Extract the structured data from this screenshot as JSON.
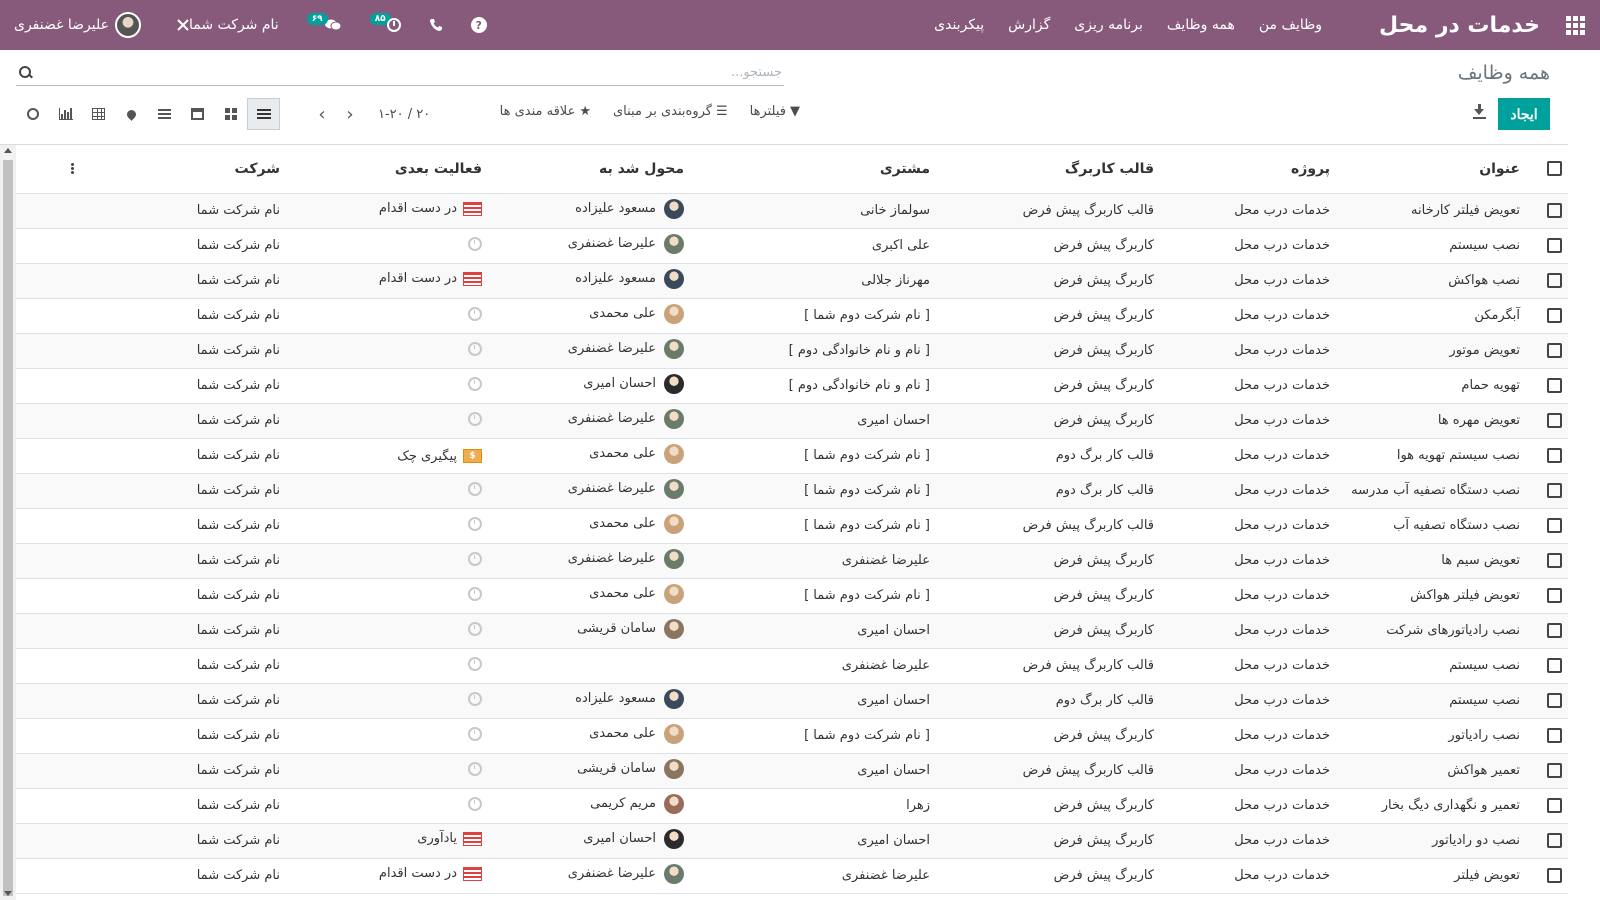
{
  "navbar": {
    "brand": "خدمات در محل",
    "menu": [
      "وظایف من",
      "همه وظایف",
      "برنامه ریزی",
      "گزارش",
      "پیکربندی"
    ],
    "user_name": "علیرضا غضنفری",
    "company_name": "نام شرکت شما",
    "messages_count": "۶۹",
    "activities_count": "۸۵"
  },
  "control": {
    "breadcrumb": "همه وظایف",
    "search_placeholder": "جستجو...",
    "create_label": "ایجاد",
    "filters_label": "فیلترها",
    "groupby_label": "گروه‌بندی بر مبنای",
    "favorites_label": "علاقه مندی ها",
    "pager_value": "۱-۲۰ / ۲۰"
  },
  "table": {
    "headers": {
      "title": "عنوان",
      "project": "پروژه",
      "template": "قالب کاربرگ",
      "customer": "مشتری",
      "assignee": "محول شد به",
      "next_activity": "فعالیت بعدی",
      "company": "شرکت"
    },
    "rows": [
      {
        "title": "تعویض فیلتر کارخانه",
        "project": "خدمات درب محل",
        "template": "قالب کاربرگ پیش فرض",
        "customer": "سولماز خانی",
        "assignee": "مسعود علیزاده",
        "av": "masoud",
        "activity": "در دست اقدام",
        "act": "todo",
        "company": "نام شرکت شما"
      },
      {
        "title": "نصب سیستم",
        "project": "خدمات درب محل",
        "template": "کاربرگ پیش فرض",
        "customer": "علی اکبری",
        "assignee": "علیرضا غضنفری",
        "av": "alireza",
        "activity": "",
        "act": "none",
        "company": "نام شرکت شما"
      },
      {
        "title": "نصب هواکش",
        "project": "خدمات درب محل",
        "template": "کاربرگ پیش فرض",
        "customer": "مهرناز جلالی",
        "assignee": "مسعود علیزاده",
        "av": "masoud",
        "activity": "در دست اقدام",
        "act": "todo",
        "company": "نام شرکت شما"
      },
      {
        "title": "آبگرمکن",
        "project": "خدمات درب محل",
        "template": "کاربرگ پیش فرض",
        "customer": "[ نام شرکت دوم شما ]",
        "assignee": "علی محمدی",
        "av": "ali",
        "activity": "",
        "act": "none",
        "company": "نام شرکت شما"
      },
      {
        "title": "تعویض موتور",
        "project": "خدمات درب محل",
        "template": "کاربرگ پیش فرض",
        "customer": "[ نام و نام خانوادگی دوم ]",
        "assignee": "علیرضا غضنفری",
        "av": "alireza",
        "activity": "",
        "act": "none",
        "company": "نام شرکت شما"
      },
      {
        "title": "تهویه حمام",
        "project": "خدمات درب محل",
        "template": "کاربرگ پیش فرض",
        "customer": "[ نام و نام خانوادگی دوم ]",
        "assignee": "احسان امیری",
        "av": "ehsan",
        "activity": "",
        "act": "none",
        "company": "نام شرکت شما"
      },
      {
        "title": "تعویض مهره ها",
        "project": "خدمات درب محل",
        "template": "کاربرگ پیش فرض",
        "customer": "احسان امیری",
        "assignee": "علیرضا غضنفری",
        "av": "alireza",
        "activity": "",
        "act": "none",
        "company": "نام شرکت شما"
      },
      {
        "title": "نصب سیستم تهویه هوا",
        "project": "خدمات درب محل",
        "template": "قالب کار برگ دوم",
        "customer": "[ نام شرکت دوم شما ]",
        "assignee": "علی محمدی",
        "av": "ali",
        "activity": "پیگیری چک",
        "act": "money",
        "company": "نام شرکت شما"
      },
      {
        "title": "نصب دستگاه تصفیه آب مدرسه",
        "project": "خدمات درب محل",
        "template": "قالب کار برگ دوم",
        "customer": "[ نام شرکت دوم شما ]",
        "assignee": "علیرضا غضنفری",
        "av": "alireza",
        "activity": "",
        "act": "none",
        "company": "نام شرکت شما"
      },
      {
        "title": "نصب دستگاه تصفیه آب",
        "project": "خدمات درب محل",
        "template": "قالب کاربرگ پیش فرض",
        "customer": "[ نام شرکت دوم شما ]",
        "assignee": "علی محمدی",
        "av": "ali",
        "activity": "",
        "act": "none",
        "company": "نام شرکت شما"
      },
      {
        "title": "تعویض سیم ها",
        "project": "خدمات درب محل",
        "template": "کاربرگ پیش فرض",
        "customer": "علیرضا غضنفری",
        "assignee": "علیرضا غضنفری",
        "av": "alireza",
        "activity": "",
        "act": "none",
        "company": "نام شرکت شما"
      },
      {
        "title": "تعویض فیلتر هواکش",
        "project": "خدمات درب محل",
        "template": "کاربرگ پیش فرض",
        "customer": "[ نام شرکت دوم شما ]",
        "assignee": "علی محمدی",
        "av": "ali",
        "activity": "",
        "act": "none",
        "company": "نام شرکت شما"
      },
      {
        "title": "نصب رادیاتورهای شرکت",
        "project": "خدمات درب محل",
        "template": "کاربرگ پیش فرض",
        "customer": "احسان امیری",
        "assignee": "سامان قریشی",
        "av": "saman",
        "activity": "",
        "act": "none",
        "company": "نام شرکت شما"
      },
      {
        "title": "نصب سیستم",
        "project": "خدمات درب محل",
        "template": "قالب کاربرگ پیش فرض",
        "customer": "علیرضا غضنفری",
        "assignee": "",
        "av": "",
        "activity": "",
        "act": "none",
        "company": "نام شرکت شما"
      },
      {
        "title": "نصب سیستم",
        "project": "خدمات درب محل",
        "template": "قالب کار برگ دوم",
        "customer": "احسان امیری",
        "assignee": "مسعود علیزاده",
        "av": "masoud",
        "activity": "",
        "act": "none",
        "company": "نام شرکت شما"
      },
      {
        "title": "نصب رادیاتور",
        "project": "خدمات درب محل",
        "template": "کاربرگ پیش فرض",
        "customer": "[ نام شرکت دوم شما ]",
        "assignee": "علی محمدی",
        "av": "ali",
        "activity": "",
        "act": "none",
        "company": "نام شرکت شما"
      },
      {
        "title": "تعمیر هواکش",
        "project": "خدمات درب محل",
        "template": "قالب کاربرگ پیش فرض",
        "customer": "احسان امیری",
        "assignee": "سامان قریشی",
        "av": "saman",
        "activity": "",
        "act": "none",
        "company": "نام شرکت شما"
      },
      {
        "title": "تعمیر و نگهداری دیگ بخار",
        "project": "خدمات درب محل",
        "template": "کاربرگ پیش فرض",
        "customer": "زهرا",
        "assignee": "مریم کریمی",
        "av": "maryam",
        "activity": "",
        "act": "none",
        "company": "نام شرکت شما"
      },
      {
        "title": "نصب دو رادیاتور",
        "project": "خدمات درب محل",
        "template": "کاربرگ پیش فرض",
        "customer": "احسان امیری",
        "assignee": "احسان امیری",
        "av": "ehsan",
        "activity": "یادآوری",
        "act": "todo",
        "company": "نام شرکت شما"
      },
      {
        "title": "تعویض فیلتر",
        "project": "خدمات درب محل",
        "template": "کاربرگ پیش فرض",
        "customer": "علیرضا غضنفری",
        "assignee": "علیرضا غضنفری",
        "av": "alireza",
        "activity": "در دست اقدام",
        "act": "todo",
        "company": "نام شرکت شما"
      }
    ]
  },
  "avatars": {
    "masoud": "#3a4a5c",
    "alireza": "#6a7b6a",
    "ali": "#c9a27a",
    "ehsan": "#2b2b2b",
    "saman": "#8a7560",
    "maryam": "#9b6b5a"
  },
  "colors": {
    "navbar": "#875a7b",
    "primary_button": "#00a09d",
    "badge": "#00a09d"
  }
}
